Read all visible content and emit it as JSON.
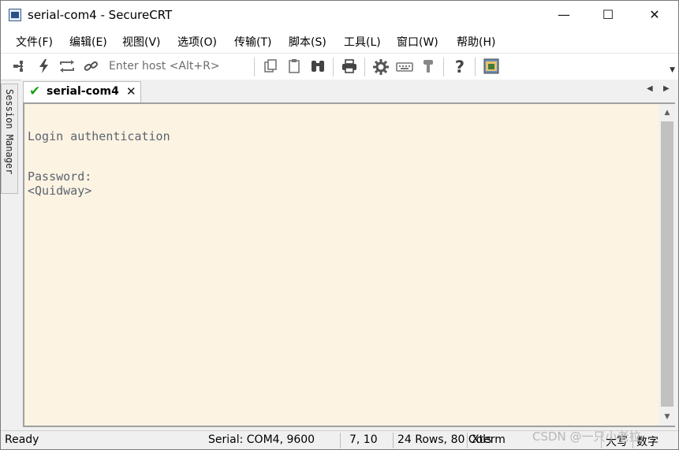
{
  "window": {
    "title": "serial-com4 - SecureCRT",
    "controls": {
      "minimize": "—",
      "maximize": "☐",
      "close": "✕"
    }
  },
  "menu": [
    "文件(F)",
    "编辑(E)",
    "视图(V)",
    "选项(O)",
    "传输(T)",
    "脚本(S)",
    "工具(L)",
    "窗口(W)",
    "帮助(H)"
  ],
  "toolbar": {
    "host_placeholder": "Enter host <Alt+R>",
    "icons": [
      "connect-bar-icon",
      "lightning-icon",
      "reconnect-icon",
      "disconnect-link-icon",
      "copy-icon",
      "paste-icon",
      "binoculars-icon",
      "print-icon",
      "gear-icon",
      "keymap-icon",
      "key-icon",
      "help-icon",
      "sftp-icon"
    ]
  },
  "session_manager": {
    "label": "Session Manager"
  },
  "tabs": [
    {
      "label": "serial-com4",
      "status": "connected",
      "close": "✕"
    }
  ],
  "terminal": {
    "background": "#fcf3e2",
    "text_color": "#5b6470",
    "lines": [
      "",
      "Login authentication",
      "",
      "",
      "Password:",
      "<Quidway>"
    ]
  },
  "status": {
    "state": "Ready",
    "connection": "Serial: COM4, 9600",
    "cursor": "7, 10",
    "size": "24 Rows, 80 Cols",
    "emulation": "Xterm",
    "caps": "大写",
    "num": "数字"
  },
  "watermark": "CSDN @一只小老拉"
}
